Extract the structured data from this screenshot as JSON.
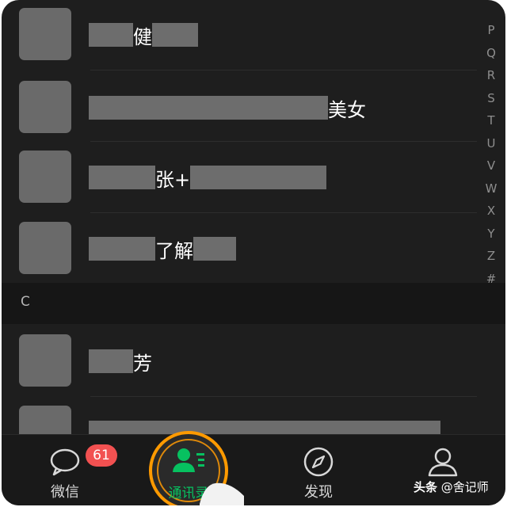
{
  "contacts_top": [
    {
      "name_mid": "健"
    },
    {
      "name_mid": "美女"
    },
    {
      "name_mid": "张+"
    },
    {
      "name_mid": "了解"
    }
  ],
  "section": {
    "letter": "C"
  },
  "contacts_bottom": [
    {
      "name_mid": "芳"
    },
    {
      "name_mid": ""
    }
  ],
  "index_letters": [
    "P",
    "Q",
    "R",
    "S",
    "T",
    "U",
    "V",
    "W",
    "X",
    "Y",
    "Z",
    "#"
  ],
  "tabbar": {
    "tabs": [
      {
        "label": "微信",
        "icon": "chat-bubble-icon",
        "badge": "61"
      },
      {
        "label": "通讯录",
        "icon": "contacts-icon",
        "active": true
      },
      {
        "label": "发现",
        "icon": "compass-icon"
      },
      {
        "label": "我",
        "icon": "person-icon"
      }
    ]
  },
  "watermark": {
    "brand": "头条",
    "handle": "@舍记师"
  },
  "colors": {
    "background": "#1e1e1e",
    "accent": "#07c160",
    "badge": "#f25151",
    "highlight": "#ff9a00"
  }
}
